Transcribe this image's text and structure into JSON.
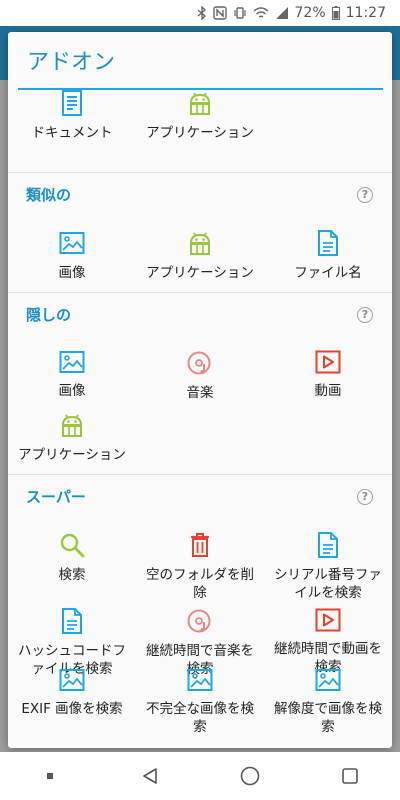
{
  "status": {
    "battery": "72%",
    "time": "11:27"
  },
  "dialog": {
    "title": "アドオン"
  },
  "top_items": [
    {
      "label": "ドキュメント",
      "icon": "document-icon",
      "color": "#1ea7e1"
    },
    {
      "label": "アプリケーション",
      "icon": "android-icon",
      "color": "#9bc53d"
    }
  ],
  "sections": [
    {
      "title": "類似の",
      "items": [
        {
          "label": "画像",
          "icon": "image-icon",
          "color": "#1ea7e1"
        },
        {
          "label": "アプリケーション",
          "icon": "android-icon",
          "color": "#9bc53d"
        },
        {
          "label": "ファイル名",
          "icon": "file-icon",
          "color": "#1ea7e1"
        }
      ]
    },
    {
      "title": "隠しの",
      "items": [
        {
          "label": "画像",
          "icon": "image-icon",
          "color": "#1ea7e1"
        },
        {
          "label": "音楽",
          "icon": "music-disc-icon",
          "color": "#e88787"
        },
        {
          "label": "動画",
          "icon": "video-play-icon",
          "color": "#e2432a"
        },
        {
          "label": "アプリケーション",
          "icon": "android-icon",
          "color": "#9bc53d"
        }
      ]
    },
    {
      "title": "スーパー",
      "items": [
        {
          "label": "検索",
          "icon": "search-icon",
          "color": "#9bc53d"
        },
        {
          "label": "空のフォルダを削除",
          "icon": "trash-icon",
          "color": "#e2432a"
        },
        {
          "label": "シリアル番号ファイルを検索",
          "icon": "file-icon",
          "color": "#1ea7e1"
        },
        {
          "label": "ハッシュコードファイルを検索",
          "icon": "file-icon",
          "color": "#1ea7e1"
        },
        {
          "label": "継続時間で音楽を検索",
          "icon": "music-disc-icon",
          "color": "#e88787"
        },
        {
          "label": "継続時間で動画を検索",
          "icon": "video-play-icon",
          "color": "#e2432a"
        },
        {
          "label": "EXIF 画像を検索",
          "icon": "image-icon",
          "color": "#1ea7e1"
        },
        {
          "label": "不完全な画像を検索",
          "icon": "image-icon",
          "color": "#1ea7e1"
        },
        {
          "label": "解像度で画像を検索",
          "icon": "image-icon",
          "color": "#1ea7e1"
        }
      ]
    }
  ],
  "help_glyph": "?"
}
